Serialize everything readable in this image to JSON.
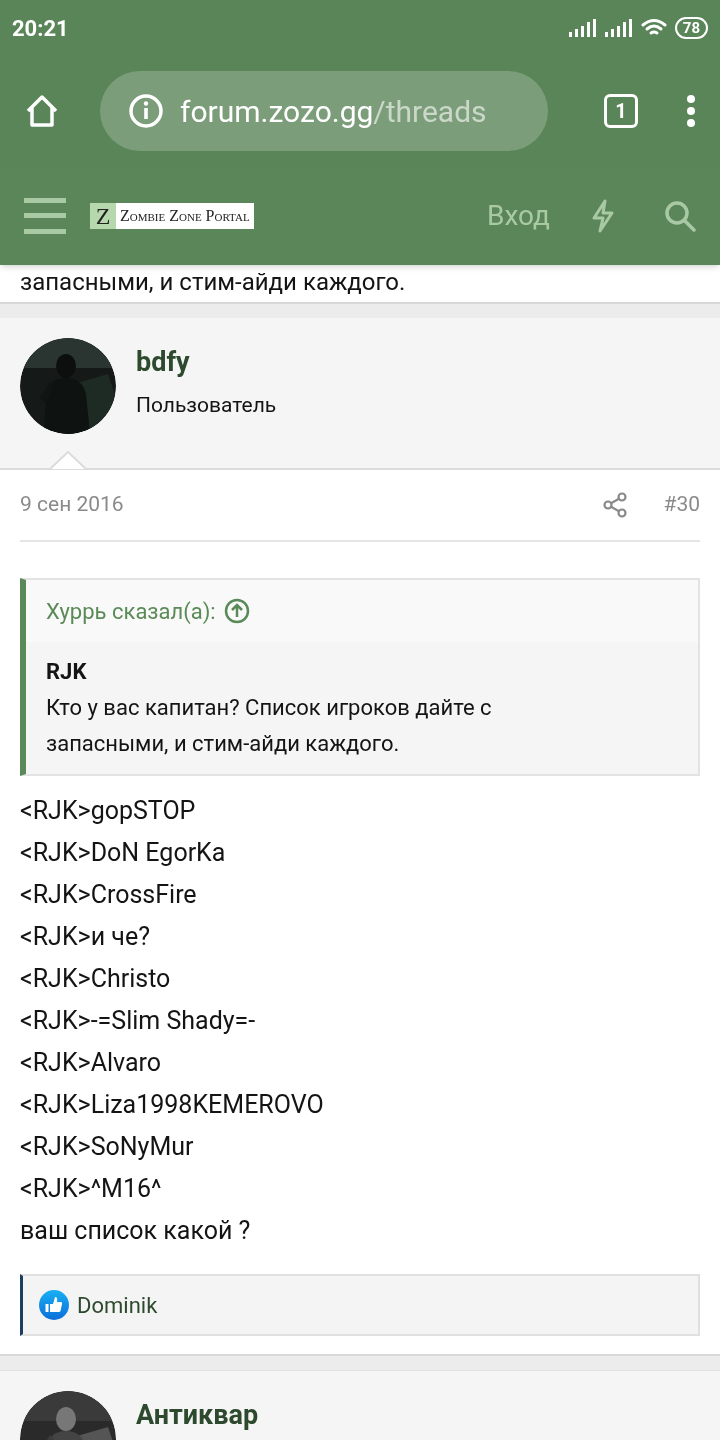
{
  "status_bar": {
    "time": "20:21",
    "battery": "78"
  },
  "browser": {
    "url_host": "forum.zozo.gg",
    "url_path": "/threads",
    "tab_count": "1"
  },
  "forum_header": {
    "logo_letter": "Z",
    "logo_text": "Zombie Zone Portal",
    "login": "Вход"
  },
  "previous_post_tail": "запасными, и стим-айди каждого.",
  "post": {
    "author": "bdfy",
    "role": "Пользователь",
    "date": "9 сен 2016",
    "number": "#30",
    "quote": {
      "attribution": "Хуррь сказал(а):",
      "author": "RJK",
      "text": "Кто у вас капитан? Список игроков дайте с запасными, и стим-айди каждого."
    },
    "lines": [
      "<RJK>gopSTOP",
      "<RJK>DoN EgorKa",
      "<RJK>CrossFire",
      "<RJK>и че?",
      "<RJK>Christo",
      "<RJK>-=Slim Shady=-",
      "<RJK>Alvaro",
      "<RJK>Liza1998KEMEROVO",
      "<RJK>SoNyMur",
      "<RJK>^M16^",
      "ваш список какой ?"
    ],
    "reactions": [
      "Dominik"
    ]
  },
  "next_post": {
    "author": "Антиквар"
  }
}
